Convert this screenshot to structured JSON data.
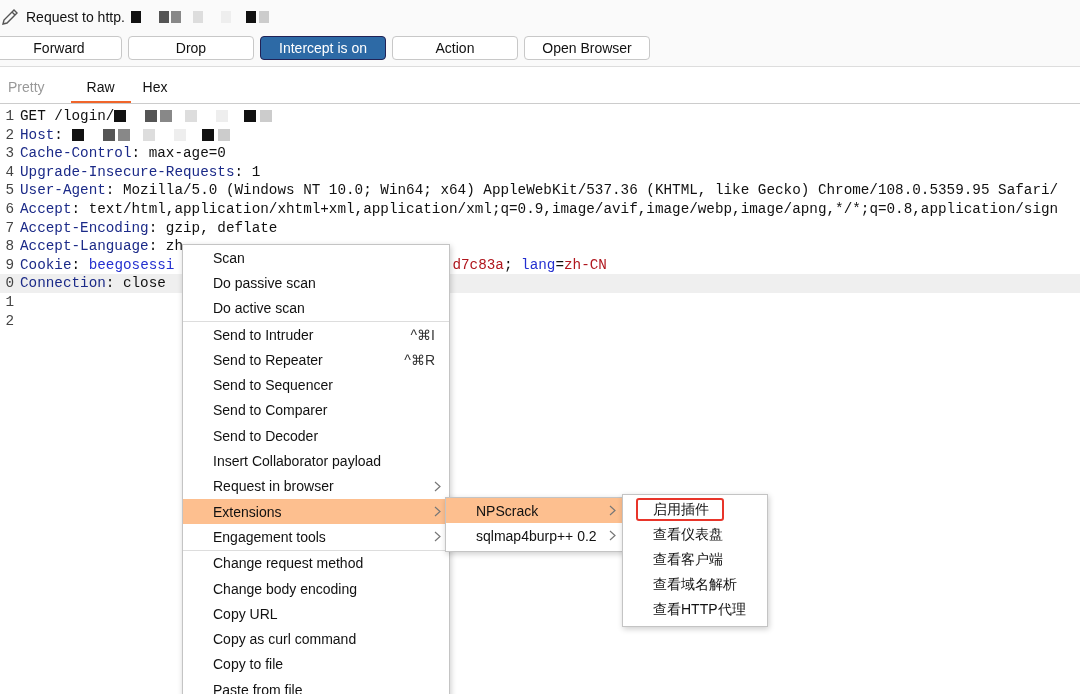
{
  "title": {
    "text": "Request to http.",
    "redacted": true
  },
  "buttons": [
    {
      "label": "Forward",
      "on": false
    },
    {
      "label": "Drop",
      "on": false
    },
    {
      "label": "Intercept is on",
      "on": true
    },
    {
      "label": "Action",
      "on": false
    },
    {
      "label": "Open Browser",
      "on": false
    }
  ],
  "tabs": [
    {
      "label": "Pretty",
      "selected": false,
      "disabled": true
    },
    {
      "label": "Raw",
      "selected": true,
      "disabled": false
    },
    {
      "label": "Hex",
      "selected": false,
      "disabled": false
    }
  ],
  "lines": [
    {
      "number": "1",
      "current": false,
      "redacted": true,
      "segments": [
        {
          "kind": "value",
          "text": "GET /login/"
        }
      ]
    },
    {
      "number": "2",
      "current": false,
      "redacted": true,
      "segments": [
        {
          "kind": "name",
          "text": "Host"
        },
        {
          "kind": "value",
          "text": ": "
        }
      ]
    },
    {
      "number": "3",
      "current": false,
      "segments": [
        {
          "kind": "name",
          "text": "Cache-Control"
        },
        {
          "kind": "value",
          "text": ": max-age=0"
        }
      ]
    },
    {
      "number": "4",
      "current": false,
      "segments": [
        {
          "kind": "name",
          "text": "Upgrade-Insecure-Requests"
        },
        {
          "kind": "value",
          "text": ": 1"
        }
      ]
    },
    {
      "number": "5",
      "current": false,
      "segments": [
        {
          "kind": "name",
          "text": "User-Agent"
        },
        {
          "kind": "value",
          "text": ": Mozilla/5.0 (Windows NT 10.0; Win64; x64) AppleWebKit/537.36 (KHTML, like Gecko) Chrome/108.0.5359.95 Safari/"
        }
      ]
    },
    {
      "number": "6",
      "current": false,
      "segments": [
        {
          "kind": "name",
          "text": "Accept"
        },
        {
          "kind": "value",
          "text": ": text/html,application/xhtml+xml,application/xml;q=0.9,image/avif,image/webp,image/apng,*/*;q=0.8,application/sign"
        }
      ]
    },
    {
      "number": "7",
      "current": false,
      "segments": [
        {
          "kind": "name",
          "text": "Accept-Encoding"
        },
        {
          "kind": "value",
          "text": ": gzip, deflate"
        }
      ]
    },
    {
      "number": "8",
      "current": false,
      "segments": [
        {
          "kind": "name",
          "text": "Accept-Language"
        },
        {
          "kind": "value",
          "text": ": zh"
        }
      ]
    },
    {
      "number": "9",
      "current": false,
      "segments": [
        {
          "kind": "name",
          "text": "Cookie"
        },
        {
          "kind": "value",
          "text": ": "
        },
        {
          "kind": "param",
          "text": "beegosessi"
        },
        {
          "kind": "covered"
        },
        {
          "kind": "string",
          "text": "d7c83a"
        },
        {
          "kind": "value",
          "text": "; "
        },
        {
          "kind": "param",
          "text": "lang"
        },
        {
          "kind": "value",
          "text": "="
        },
        {
          "kind": "string",
          "text": "zh-CN"
        }
      ]
    },
    {
      "number": "0",
      "current": true,
      "segments": [
        {
          "kind": "name",
          "text": "Connection"
        },
        {
          "kind": "value",
          "text": ": close"
        }
      ]
    },
    {
      "number": "1",
      "current": false
    },
    {
      "number": "2",
      "current": false
    }
  ],
  "context_menu": {
    "groups": [
      [
        {
          "label": "Scan",
          "selected": false
        },
        {
          "label": "Do passive scan",
          "selected": false
        },
        {
          "label": "Do active scan",
          "selected": false
        }
      ],
      [
        {
          "label": "Send to Intruder",
          "shortcut": "^⌘I",
          "selected": false
        },
        {
          "label": "Send to Repeater",
          "shortcut": "^⌘R",
          "selected": false
        },
        {
          "label": "Send to Sequencer",
          "selected": false
        },
        {
          "label": "Send to Comparer",
          "selected": false
        },
        {
          "label": "Send to Decoder",
          "selected": false
        },
        {
          "label": "Insert Collaborator payload",
          "selected": false
        },
        {
          "label": "Request in browser",
          "submenu": true,
          "selected": false
        },
        {
          "label": "Extensions",
          "submenu": true,
          "selected": true
        },
        {
          "label": "Engagement tools",
          "submenu": true,
          "selected": false
        }
      ],
      [
        {
          "label": "Change request method",
          "selected": false
        },
        {
          "label": "Change body encoding",
          "selected": false
        },
        {
          "label": "Copy URL",
          "selected": false
        },
        {
          "label": "Copy as curl command",
          "selected": false
        },
        {
          "label": "Copy to file",
          "selected": false
        },
        {
          "label": "Paste from file",
          "selected": false
        }
      ]
    ]
  },
  "extensions_menu": [
    {
      "label": "NPScrack",
      "submenu": true,
      "selected": true
    },
    {
      "label": "sqlmap4burp++ 0.2",
      "submenu": true,
      "selected": false
    }
  ],
  "npscrack_menu": [
    {
      "label": "启用插件",
      "highlighted": true
    },
    {
      "label": "查看仪表盘",
      "highlighted": false
    },
    {
      "label": "查看客户端",
      "highlighted": false
    },
    {
      "label": "查看域名解析",
      "highlighted": false
    },
    {
      "label": "查看HTTP代理",
      "highlighted": false
    }
  ]
}
